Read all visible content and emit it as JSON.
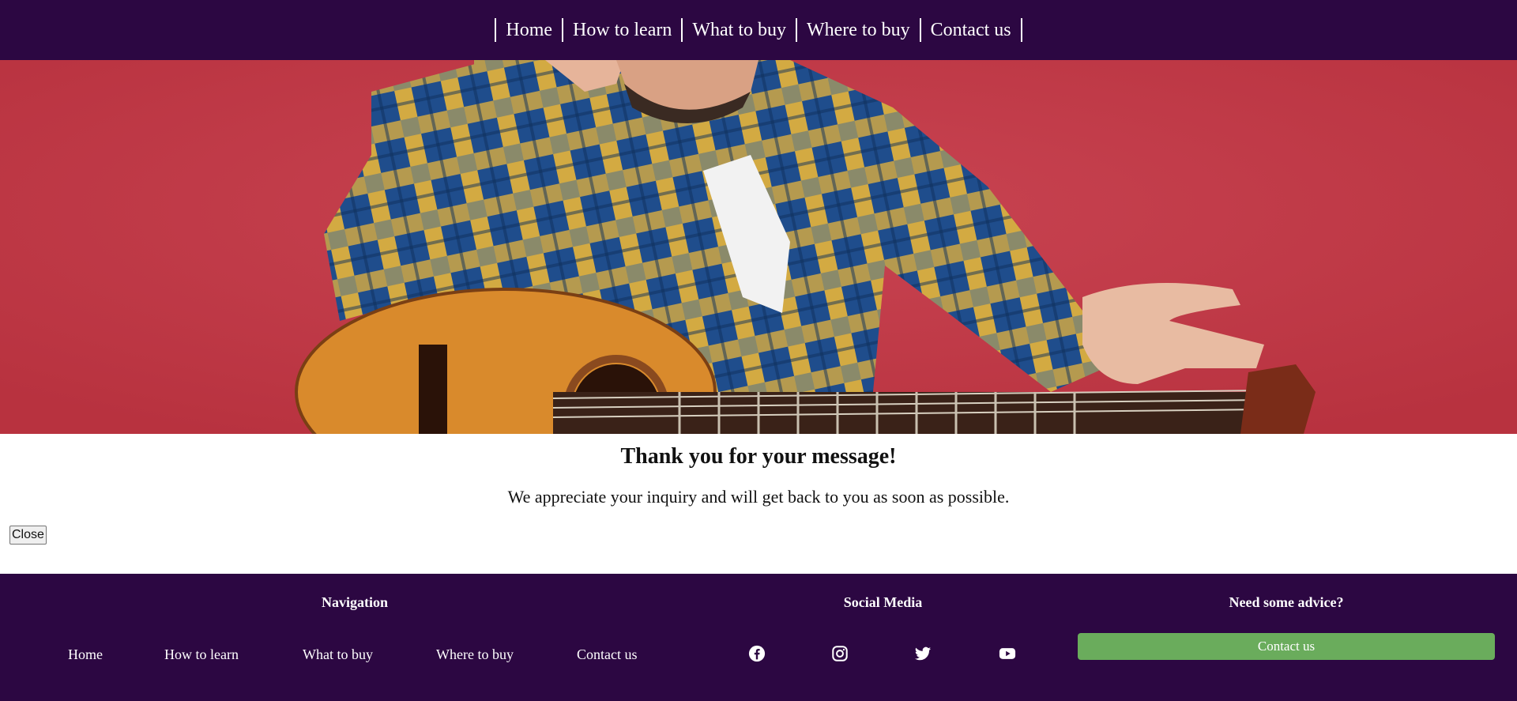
{
  "topnav": {
    "items": [
      "Home",
      "How to learn",
      "What to buy",
      "Where to buy",
      "Contact us"
    ]
  },
  "hero": {
    "background_color": "#c33a49",
    "shirt_colors": [
      "#1f4d8c",
      "#e7b43a",
      "#8a8a6a"
    ],
    "guitar_color": "#d98a2c"
  },
  "message": {
    "title": "Thank you for your message!",
    "text": "We appreciate your inquiry and will get back to you as soon as possible.",
    "close_label": "Close"
  },
  "footer": {
    "nav_title": "Navigation",
    "nav_items": [
      "Home",
      "How to learn",
      "What to buy",
      "Where to buy",
      "Contact us"
    ],
    "social_title": "Social Media",
    "social_icons": [
      "facebook-icon",
      "instagram-icon",
      "twitter-icon",
      "youtube-icon"
    ],
    "advice_title": "Need some advice?",
    "advice_button": "Contact us",
    "accent_color": "#6aac5c",
    "background_color": "#2c0742"
  }
}
